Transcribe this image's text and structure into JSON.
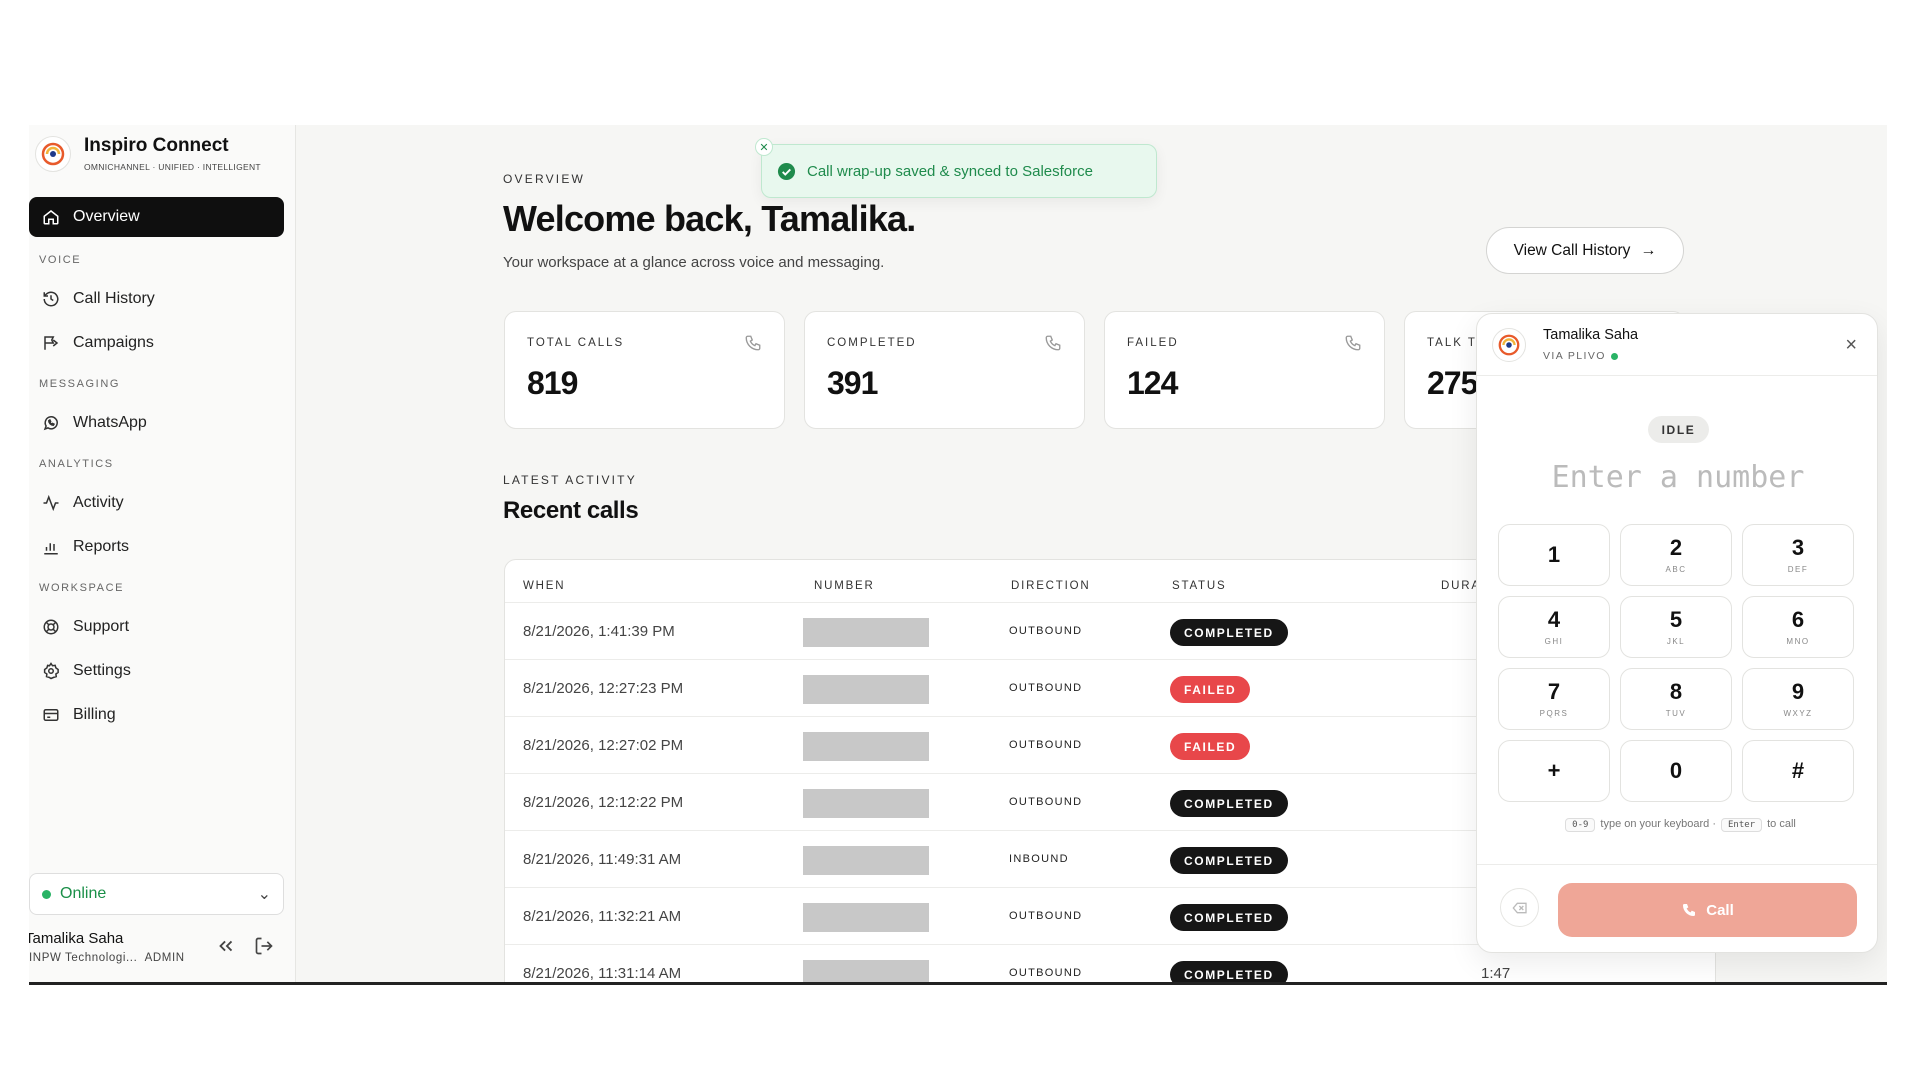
{
  "brand": {
    "name": "Inspiro Connect",
    "tagline": "OMNICHANNEL · UNIFIED · INTELLIGENT"
  },
  "sidebar": {
    "overview": "Overview",
    "sections": {
      "voice": "VOICE",
      "messaging": "MESSAGING",
      "analytics": "ANALYTICS",
      "workspace": "WORKSPACE"
    },
    "items": {
      "call_history": "Call History",
      "campaigns": "Campaigns",
      "whatsapp": "WhatsApp",
      "activity": "Activity",
      "reports": "Reports",
      "support": "Support",
      "settings": "Settings",
      "billing": "Billing"
    },
    "status": "Online",
    "user": {
      "name": "Tamalika Saha",
      "org": "INPW Technologi...",
      "role": "ADMIN"
    }
  },
  "header": {
    "kicker": "OVERVIEW",
    "title": "Welcome back, Tamalika.",
    "subtitle": "Your workspace at a glance across voice and messaging.",
    "history_button": "View Call History"
  },
  "toast": {
    "message": "Call wrap-up saved & synced to Salesforce"
  },
  "stats": [
    {
      "label": "TOTAL CALLS",
      "value": "819"
    },
    {
      "label": "COMPLETED",
      "value": "391"
    },
    {
      "label": "FAILED",
      "value": "124"
    },
    {
      "label": "TALK TI",
      "value": "275"
    }
  ],
  "recent": {
    "kicker": "LATEST ACTIVITY",
    "title": "Recent calls",
    "columns": [
      "WHEN",
      "NUMBER",
      "DIRECTION",
      "STATUS",
      "DURA"
    ],
    "rows": [
      {
        "when": "8/21/2026, 1:41:39 PM",
        "direction": "OUTBOUND",
        "status": "COMPLETED",
        "status_key": "completed",
        "duration": ""
      },
      {
        "when": "8/21/2026, 12:27:23 PM",
        "direction": "OUTBOUND",
        "status": "FAILED",
        "status_key": "failed",
        "duration": ""
      },
      {
        "when": "8/21/2026, 12:27:02 PM",
        "direction": "OUTBOUND",
        "status": "FAILED",
        "status_key": "failed",
        "duration": ""
      },
      {
        "when": "8/21/2026, 12:12:22 PM",
        "direction": "OUTBOUND",
        "status": "COMPLETED",
        "status_key": "completed",
        "duration": ""
      },
      {
        "when": "8/21/2026, 11:49:31 AM",
        "direction": "INBOUND",
        "status": "COMPLETED",
        "status_key": "completed",
        "duration": ""
      },
      {
        "when": "8/21/2026, 11:32:21 AM",
        "direction": "OUTBOUND",
        "status": "COMPLETED",
        "status_key": "completed",
        "duration": ""
      },
      {
        "when": "8/21/2026, 11:31:14 AM",
        "direction": "OUTBOUND",
        "status": "COMPLETED",
        "status_key": "completed",
        "duration": "1:47"
      }
    ]
  },
  "dialer": {
    "name": "Tamalika Saha",
    "via": "VIA PLIVO",
    "state": "IDLE",
    "placeholder": "Enter a number",
    "keys": [
      {
        "digit": "1",
        "letters": ""
      },
      {
        "digit": "2",
        "letters": "ABC"
      },
      {
        "digit": "3",
        "letters": "DEF"
      },
      {
        "digit": "4",
        "letters": "GHI"
      },
      {
        "digit": "5",
        "letters": "JKL"
      },
      {
        "digit": "6",
        "letters": "MNO"
      },
      {
        "digit": "7",
        "letters": "PQRS"
      },
      {
        "digit": "8",
        "letters": "TUV"
      },
      {
        "digit": "9",
        "letters": "WXYZ"
      },
      {
        "digit": "+",
        "letters": ""
      },
      {
        "digit": "0",
        "letters": ""
      },
      {
        "digit": "#",
        "letters": ""
      }
    ],
    "hint": {
      "keys": "0-9",
      "mid": "type on your keyboard ·",
      "enter": "Enter",
      "end": "to call"
    },
    "call_label": "Call"
  },
  "colors": {
    "accent": "#0f0f0f",
    "success": "#1f8b4c",
    "failed": "#e8474a",
    "call_button": "#efa697",
    "online": "#29b365"
  },
  "icons": {
    "nav": [
      "home-icon",
      "history-icon",
      "campaign-flag-icon",
      "whatsapp-icon",
      "activity-pulse-icon",
      "bar-chart-icon",
      "lifebuoy-icon",
      "gear-icon",
      "credit-card-icon"
    ],
    "stats": "phone-icon",
    "toast": "check-circle-icon",
    "dialer": [
      "close-icon",
      "backspace-icon",
      "phone-icon"
    ]
  }
}
